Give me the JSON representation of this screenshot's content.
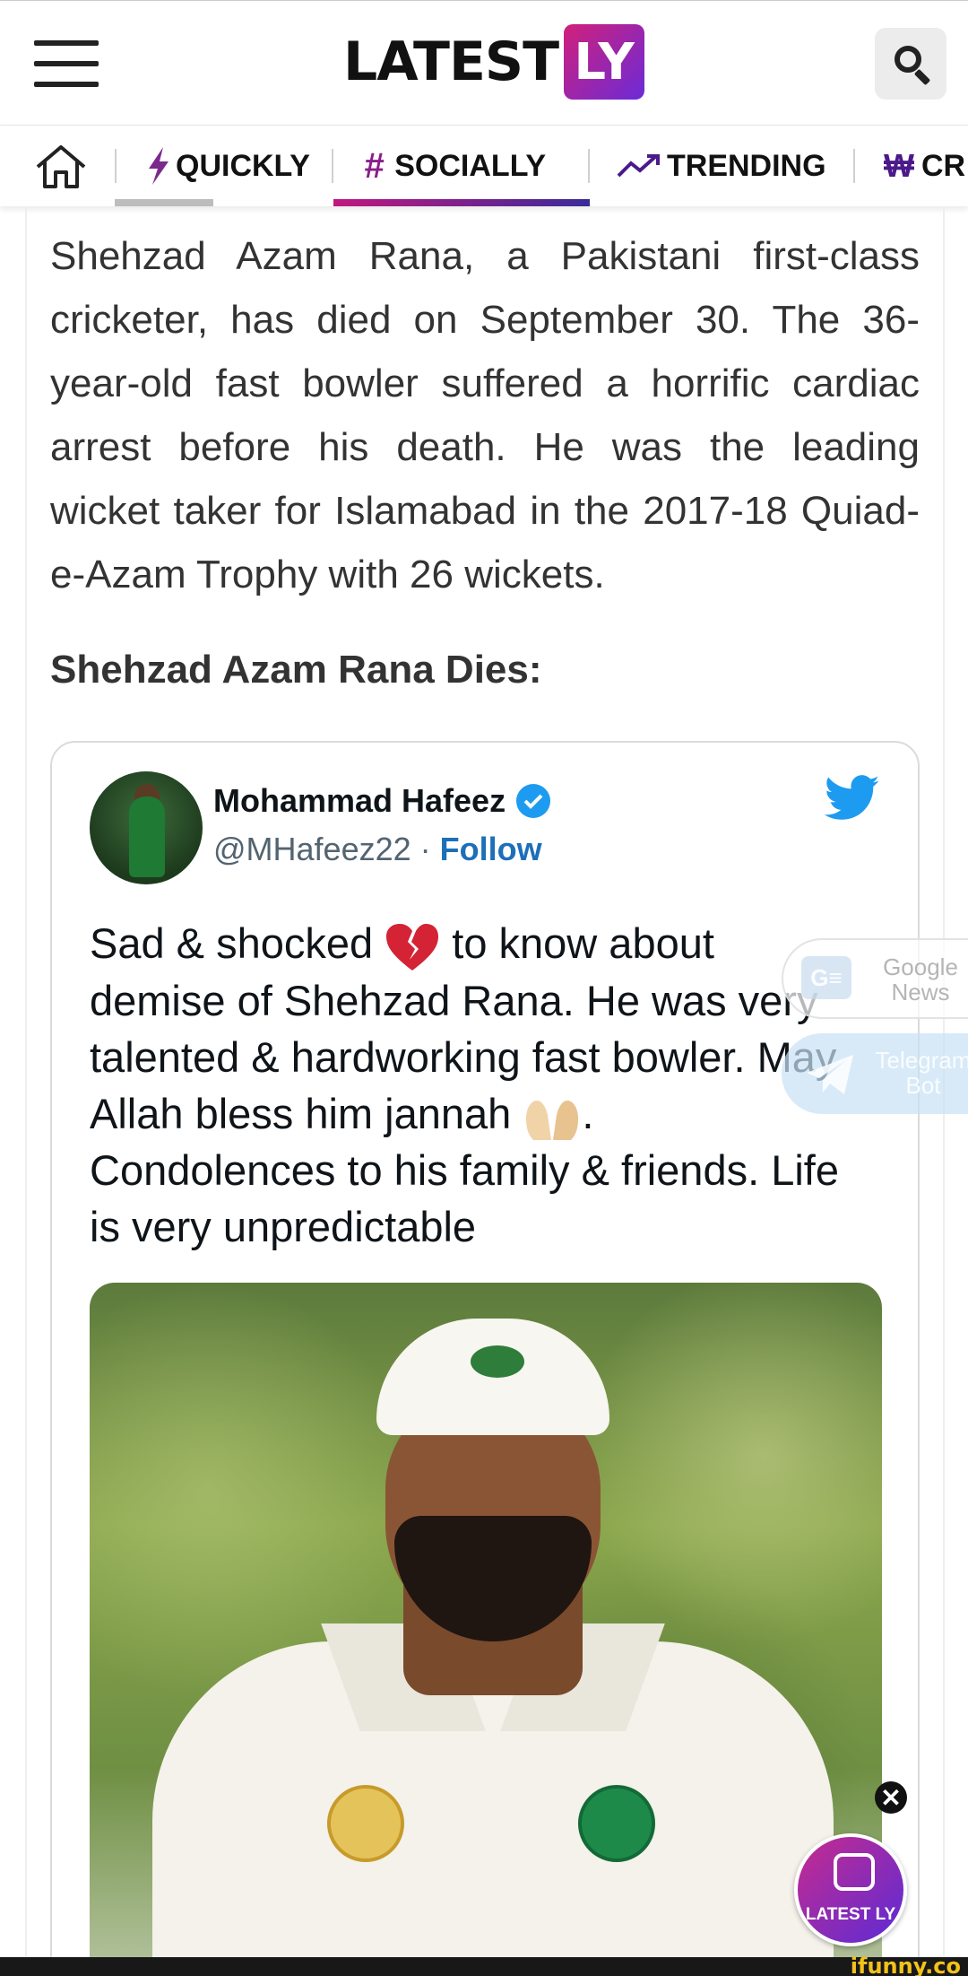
{
  "header": {
    "logo_text": "LATEST",
    "logo_badge": "LY",
    "menu_icon": "hamburger-menu-icon",
    "search_icon": "search-icon"
  },
  "nav": {
    "items": [
      {
        "label": "QUICKLY",
        "icon": "lightning-icon"
      },
      {
        "label": "SOCIALLY",
        "icon": "hashtag-icon"
      },
      {
        "label": "TRENDING",
        "icon": "trending-up-icon"
      },
      {
        "label": "CR",
        "icon": "currency-icon"
      }
    ],
    "active": "SOCIALLY",
    "colors": {
      "quickly": "#7b2a8c",
      "socially": "#8a1e8a",
      "trending": "#4b1a8a",
      "active_underline": "#c0187e"
    }
  },
  "article": {
    "body": "Shehzad Azam Rana, a Pakistani first-class cricketer, has died on September 30. The 36-year-old fast bowler suffered a horrific cardiac arrest before his death. He was the leading wicket taker for Islamabad in the 2017-18 Quiad-e-Azam Trophy with 26 wickets.",
    "subheading": "Shehzad Azam Rana Dies:"
  },
  "tweet": {
    "name": "Mohammad Hafeez",
    "handle": "@MHafeez22",
    "separator": "·",
    "follow_label": "Follow",
    "text_part1": "Sad & shocked ",
    "text_part2": " to know about demise of Shehzad Rana. He was very talented & hardworking fast bowler. May Allah bless him jannah ",
    "text_part3": ". Condolences to his family & friends. Life is very unpredictable",
    "emoji1": "broken-heart",
    "emoji2": "palms-up",
    "photo_alt": "cricketer-portrait"
  },
  "widgets": {
    "gnews_label": "Google News",
    "gnews_icon_text": "G≡",
    "telegram_label": "Telegram Bot",
    "bot_label": "LATEST LY",
    "close_symbol": "✕"
  },
  "footer": {
    "watermark": "ifunny.co"
  }
}
